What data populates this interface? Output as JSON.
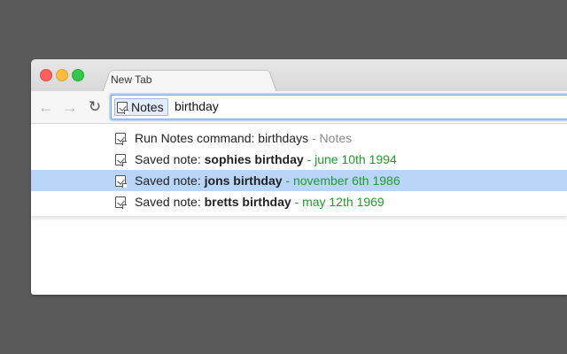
{
  "browser": {
    "tab_title": "New Tab",
    "omnibox": {
      "keyword_label": "Notes",
      "query": "birthday"
    }
  },
  "suggestions": [
    {
      "prefix": "Run Notes command: birthdays",
      "separator": " - ",
      "detail": "Notes",
      "detail_kind": "description"
    },
    {
      "prefix": "Saved note: ",
      "title": "sophies birthday",
      "separator": " - ",
      "detail": "june 10th 1994",
      "detail_kind": "date"
    },
    {
      "prefix": "Saved note: ",
      "title": "jons birthday",
      "separator": " - ",
      "detail": "november 6th 1986",
      "detail_kind": "date",
      "selected": true
    },
    {
      "prefix": "Saved note: ",
      "title": "bretts birthday",
      "separator": " - ",
      "detail": "may 12th 1969",
      "detail_kind": "date"
    }
  ],
  "icons": {
    "back": "back-arrow-icon",
    "forward": "forward-arrow-icon",
    "reload": "reload-icon",
    "note": "note-icon"
  },
  "colors": {
    "desktop": "#5a5a5a",
    "selection": "#b9d6f8",
    "date_green": "#1f9a2d",
    "omnibox_focus": "#7aa7e6"
  }
}
